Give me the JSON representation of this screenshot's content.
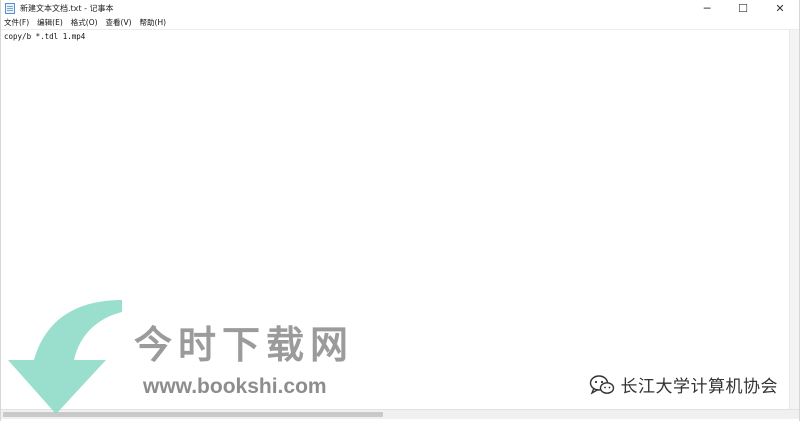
{
  "window": {
    "title": "新建文本文档.txt - 记事本",
    "controls": {
      "minimize": "─",
      "maximize": "☐",
      "close": "✕"
    }
  },
  "menubar": {
    "items": [
      {
        "label": "文件(F)"
      },
      {
        "label": "编辑(E)"
      },
      {
        "label": "格式(O)"
      },
      {
        "label": "查看(V)"
      },
      {
        "label": "帮助(H)"
      }
    ]
  },
  "editor": {
    "content": "copy/b *.tdl 1.mp4"
  },
  "watermark": {
    "brand": "今时下载网",
    "url": "www.bookshi.com",
    "wechat_account": "长江大学计算机协会",
    "arrow_color": "#8fdcc8",
    "icons": [
      "down-arrow-icon",
      "wechat-icon"
    ]
  },
  "colors": {
    "window_bg": "#ffffff",
    "scrollbar_thumb": "#c9c9c9",
    "watermark_gray": "#8a8a8a"
  }
}
